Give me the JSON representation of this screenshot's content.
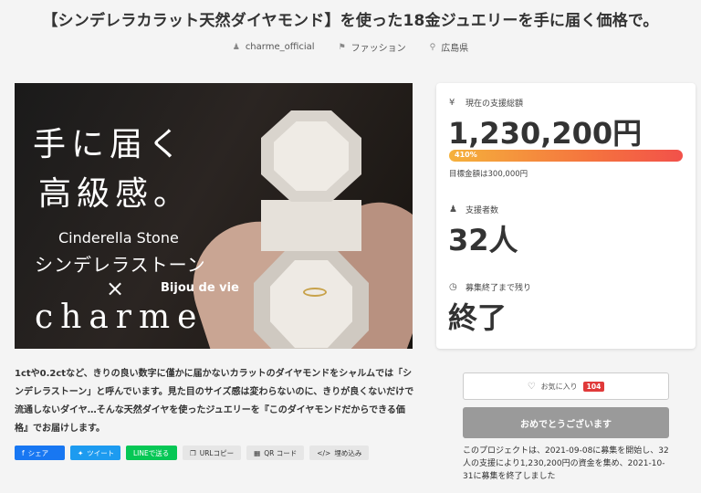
{
  "title": "【シンデレラカラット天然ダイヤモンド】を使った18金ジュエリーを手に届く価格で。",
  "meta": {
    "owner": "charme_official",
    "category": "ファッション",
    "location": "広島県"
  },
  "hero": {
    "line1": "手に届く",
    "line2": "高級感。",
    "line3": "Cinderella Stone",
    "line4": "シンデレラストーン",
    "line5": "×",
    "line6": "Bijou de vie",
    "line7": "charme"
  },
  "panel": {
    "raised_label": "現在の支援総額",
    "raised_value": "1,230,200円",
    "percent": "410%",
    "goal": "目標金額は300,000円",
    "backers_label": "支援者数",
    "backers_value": "32人",
    "remaining_label": "募集終了まで残り",
    "remaining_value": "終了"
  },
  "description": "1ctや0.2ctなど、きりの良い数字に僅かに届かないカラットのダイヤモンドをシャルムでは「シンデレラストーン」と呼んでいます。見た目のサイズ感は変わらないのに、きりが良くないだけで流通しないダイヤ…そんな天然ダイヤを使ったジュエリーを『このダイヤモンドだからできる価格』でお届けします。",
  "share": {
    "facebook": "シェア",
    "twitter": "ツイート",
    "line": "LINEで送る",
    "url_copy": "URLコピー",
    "qr": "QR コード",
    "embed": "埋め込み"
  },
  "favorite": {
    "label": "お気に入り",
    "count": "104"
  },
  "finished_button": "おめでとうございます",
  "note": "このプロジェクトは、2021-09-08に募集を開始し、32人の支援により1,230,200円の資金を集め、2021-10-31に募集を終了しました",
  "colors": {
    "progress_start": "#f5b13c",
    "progress_end": "#f2514a",
    "fav_count_bg": "#e03a3a"
  }
}
